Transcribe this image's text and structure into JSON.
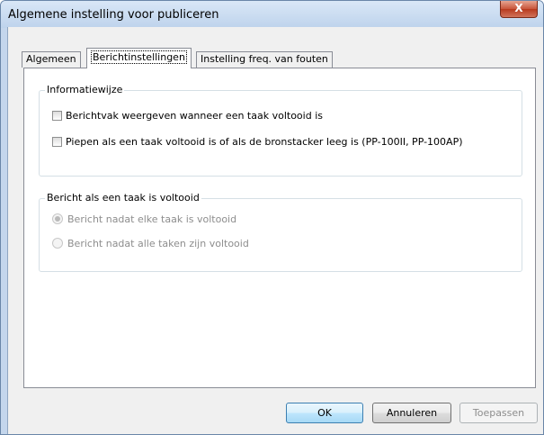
{
  "window": {
    "title": "Algemene instelling voor publiceren",
    "close_label": "X"
  },
  "tabs": [
    {
      "label": "Algemeen",
      "active": false
    },
    {
      "label": "Berichtinstellingen",
      "active": true
    },
    {
      "label": "Instelling freq. van fouten",
      "active": false
    }
  ],
  "info_group": {
    "legend": "Informatiewijze",
    "options": [
      {
        "label": "Berichtvak weergeven wanneer een taak voltooid is",
        "checked": false
      },
      {
        "label": "Piepen als een taak voltooid is of als de bronstacker leeg is (PP-100II, PP-100AP)",
        "checked": false
      }
    ]
  },
  "message_group": {
    "legend": "Bericht als een taak is voltooid",
    "options": [
      {
        "label": "Bericht nadat elke taak is voltooid",
        "checked": true,
        "enabled": false
      },
      {
        "label": "Bericht nadat alle taken zijn voltooid",
        "checked": false,
        "enabled": false
      }
    ]
  },
  "buttons": {
    "ok": "OK",
    "cancel": "Annuleren",
    "apply": "Toepassen"
  }
}
